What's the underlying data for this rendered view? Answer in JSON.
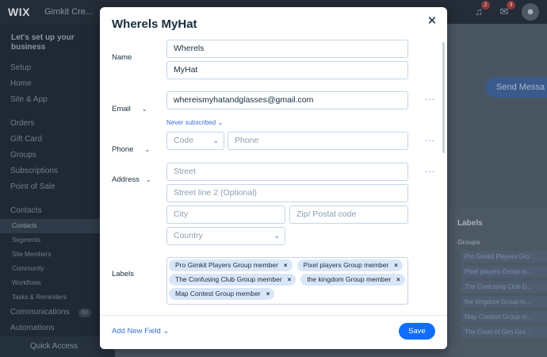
{
  "app": {
    "logo": "WIX",
    "site_name": "Gimkit Cre...",
    "notification_count_1": "2",
    "notification_count_2": "3"
  },
  "sidebar": {
    "header": "Let's set up your business",
    "items": [
      {
        "label": "Setup",
        "sub": false
      },
      {
        "label": "Home",
        "sub": false
      },
      {
        "label": "Site & App",
        "sub": false
      }
    ],
    "items2": [
      {
        "label": "Orders",
        "sub": false
      },
      {
        "label": "Gift Card",
        "sub": false
      },
      {
        "label": "Groups",
        "sub": false
      },
      {
        "label": "Subscriptions",
        "sub": false
      },
      {
        "label": "Point of Sale",
        "sub": false
      }
    ],
    "contacts": {
      "label": "Contacts"
    },
    "contact_items": [
      {
        "label": "Contacts"
      },
      {
        "label": "Segments"
      },
      {
        "label": "Site Members"
      },
      {
        "label": "Community"
      },
      {
        "label": "Workflows"
      },
      {
        "label": "Tasks & Reminders"
      }
    ],
    "communications": {
      "label": "Communications",
      "count": "60"
    },
    "automations": {
      "label": "Automations"
    },
    "quick_access": "Quick Access"
  },
  "background": {
    "send_button": "Send Messa",
    "panel_title": "Labels",
    "panel_sub": "Groups",
    "panel_chips": [
      "Pro Gimkit Players Gro...",
      "Pixel players Group m...",
      "The Confusing Club G...",
      "the kingdom Group m...",
      "Map Contest Group m...",
      "The Court of Gim Gro..."
    ]
  },
  "modal": {
    "title": "Wherels MyHat",
    "name_label": "Name",
    "first_name": "Wherels",
    "last_name": "MyHat",
    "email_label": "Email",
    "email_value": "whereismyhatandglasses@gmail.com",
    "subscription_status": "Never subscribed",
    "phone_label": "Phone",
    "phone_code_placeholder": "Code",
    "phone_placeholder": "Phone",
    "address_label": "Address",
    "street_placeholder": "Street",
    "street2_placeholder": "Street line 2 (Optional)",
    "city_placeholder": "City",
    "zip_placeholder": "Zip/ Postal code",
    "country_placeholder": "Country",
    "labels_label": "Labels",
    "labels": [
      "Pro Gimkit Players Group member",
      "Pixel players Group member",
      "The Confusing Club Group member",
      "the kingdom Group member",
      "Map Contest Group member"
    ],
    "add_field": "Add New Field",
    "save": "Save"
  }
}
